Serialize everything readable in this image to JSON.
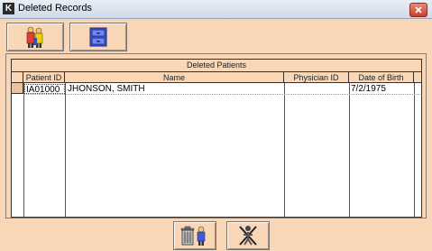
{
  "window": {
    "title": "Deleted Records",
    "app_icon_letter": "K"
  },
  "toolbar": {
    "buttons": [
      {
        "icon": "people-group-icon"
      },
      {
        "icon": "file-cabinet-icon"
      }
    ]
  },
  "table": {
    "caption": "Deleted Patients",
    "columns": [
      "Patient ID",
      "Name",
      "Physician ID",
      "Date of Birth"
    ],
    "rows": [
      {
        "patient_id": "IA01000",
        "name": "JHONSON, SMITH",
        "physician_id": "",
        "date_of_birth": "7/2/1975"
      }
    ]
  },
  "bottom_buttons": [
    {
      "icon": "trash-delete-icon"
    },
    {
      "icon": "exit-figure-icon"
    }
  ]
}
